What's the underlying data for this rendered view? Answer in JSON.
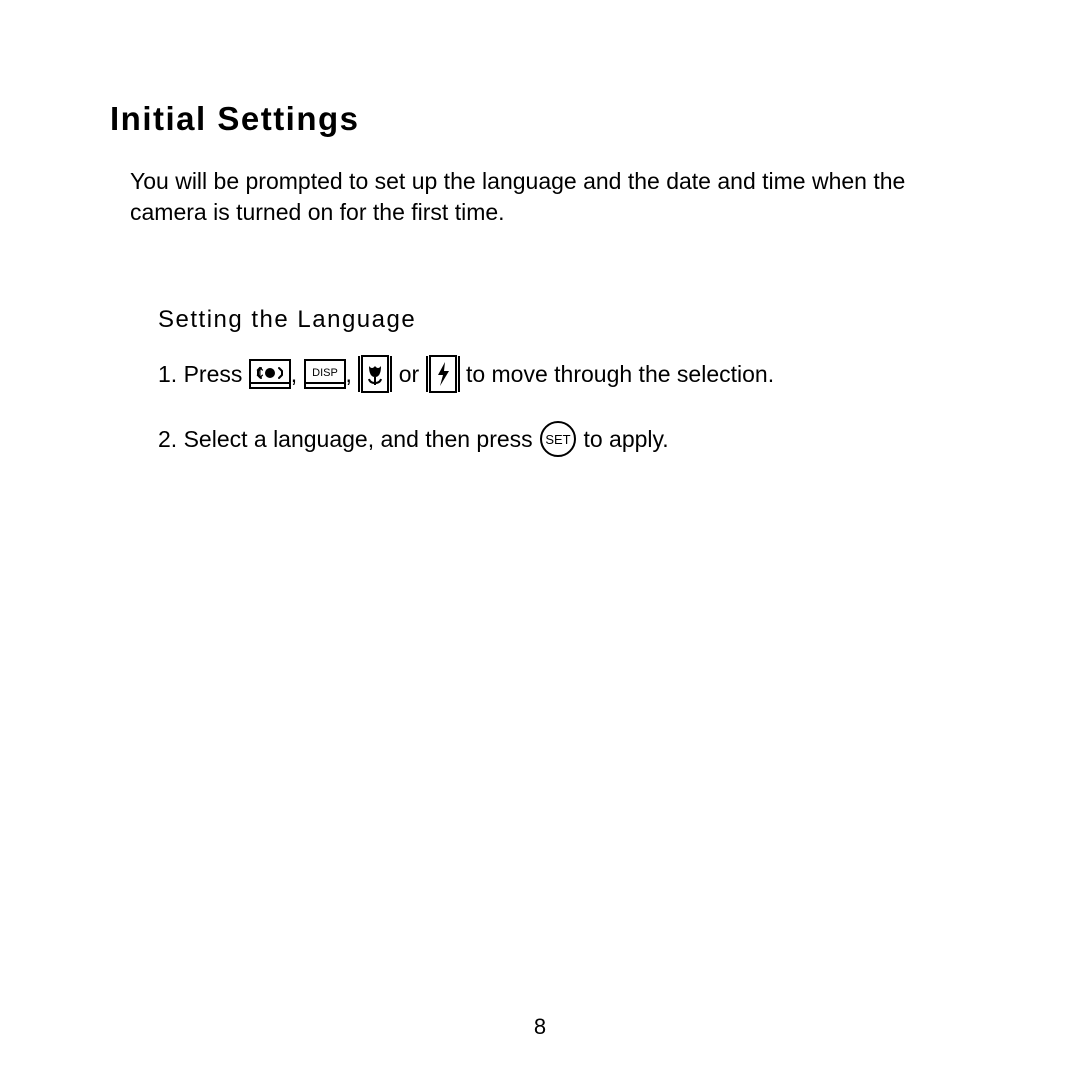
{
  "heading": "Initial Settings",
  "intro": "You will be prompted to set up the language and the date and time when the camera is turned on for the first time.",
  "subheading": "Setting the Language",
  "step1": {
    "n": "1.",
    "press": "Press ",
    "c1": ", ",
    "c2": ", ",
    "or": " or ",
    "tail": " to move through the selection."
  },
  "step2": {
    "n": "2.",
    "lead": "Select a language, and then press ",
    "tail": " to apply."
  },
  "icons": {
    "disp_label": "DISP",
    "set_label": "SET"
  },
  "page_number": "8"
}
